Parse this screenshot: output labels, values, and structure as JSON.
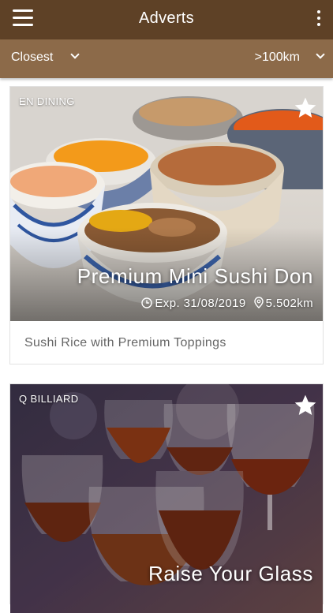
{
  "appbar": {
    "title": "Adverts",
    "menu_icon": "hamburger-menu-icon",
    "more_icon": "more-vertical-icon"
  },
  "filters": {
    "sort_label": "Closest",
    "distance_label": ">100km"
  },
  "adverts": [
    {
      "merchant": "EN DINING",
      "title": "Premium Mini Sushi Don",
      "expiry": "Exp. 31/08/2019",
      "distance": "5.502km",
      "description": "Sushi Rice with Premium Toppings"
    },
    {
      "merchant": "Q BILLIARD",
      "title": "Raise Your Glass"
    }
  ],
  "colors": {
    "appbar": "#5e4126",
    "filterbar": "#8c6a49"
  }
}
